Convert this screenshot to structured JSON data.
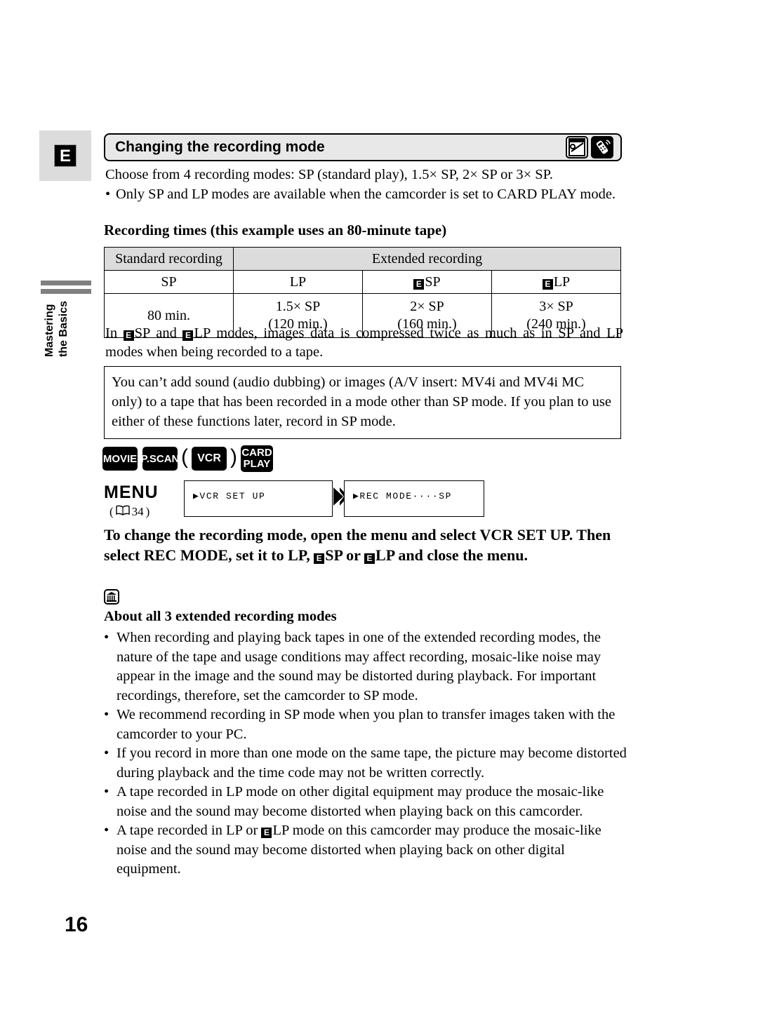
{
  "page": {
    "number": "16",
    "language_marker": "E",
    "side_tab": {
      "line1": "Mastering",
      "line2": "the Basics"
    }
  },
  "header": {
    "title": "Changing the recording mode",
    "icons": [
      "card-icon",
      "remote-control-icon"
    ]
  },
  "intro": {
    "paragraph": "Choose from 4 recording modes: SP (standard play), 1.5× SP, 2× SP or 3× SP.",
    "bullet_mark": "•",
    "bullet": "Only SP and LP modes are available when the camcorder is set to CARD PLAY mode."
  },
  "subhead": "Recording times (this example uses an 80-minute tape)",
  "chart_data": {
    "type": "table",
    "title": "Recording times (this example uses an 80-minute tape)",
    "group_headers": [
      {
        "label": "Standard recording",
        "span": 1
      },
      {
        "label": "Extended recording",
        "span": 3
      }
    ],
    "mode_row": [
      {
        "badge": "",
        "label": "SP"
      },
      {
        "badge": "",
        "label": "LP"
      },
      {
        "badge": "E",
        "label": "SP"
      },
      {
        "badge": "E",
        "label": "LP"
      }
    ],
    "time_row": [
      {
        "line1": "80 min.",
        "line2": ""
      },
      {
        "line1": "1.5× SP",
        "line2": "(120 min.)"
      },
      {
        "line1": "2× SP",
        "line2": "(160 min.)"
      },
      {
        "line1": "3× SP",
        "line2": "(240 min.)"
      }
    ]
  },
  "after_table": {
    "part1": "In ",
    "badge1": "E",
    "part2": "SP and ",
    "badge2": "E",
    "part3": "LP modes, images data is compressed twice as much as in SP and LP modes when being recorded to a tape."
  },
  "note_box": {
    "text": "You can’t add sound (audio dubbing) or images (A/V insert: MV4i and MV4i MC only) to a tape that has been recorded in a mode other than SP mode. If you plan to use either of these functions later, record in SP mode."
  },
  "badges": {
    "movie": "MOVIE",
    "pscan": "P.SCAN",
    "paren_open": "(",
    "vcr": "VCR",
    "paren_close": ")",
    "card_line1": "CARD",
    "card_line2": "PLAY"
  },
  "menu": {
    "label": "MENU",
    "ref_open": "(",
    "ref_page": "34",
    "ref_close": ")",
    "screen1": "▶VCR SET UP",
    "chevron": "❯❯",
    "screen2": "▶REC MODE····SP"
  },
  "instruction": {
    "part1": "To change the recording mode, open the menu and select VCR SET UP. Then select REC MODE, set it to LP, ",
    "badge1": "E",
    "part2": "SP or ",
    "badge2": "E",
    "part3": "LP and close the menu."
  },
  "about": {
    "icon": "note-icon",
    "heading": "About all 3 extended recording modes",
    "bullet_mark": "•",
    "bullets": [
      {
        "text": "When recording and playing back tapes in one of the extended recording modes, the nature of the tape and usage conditions may affect recording, mosaic-like noise may appear in the image and the sound may be distorted during playback. For important recordings, therefore, set the camcorder to SP mode."
      },
      {
        "text": "We recommend recording in SP mode when you plan to transfer images taken with the camcorder to your PC."
      },
      {
        "text": "If you record in more than one mode on the same tape, the picture may become distorted during playback and the time code may not be written correctly."
      },
      {
        "text": "A tape recorded in LP mode on other digital equipment may produce the mosaic-like noise and the sound may become distorted when playing back on this camcorder."
      },
      {
        "pre": "A tape recorded in LP or ",
        "badge": "E",
        "post": "LP mode on this camcorder may produce the mosaic-like noise and the sound may become distorted when playing back on other digital equipment."
      }
    ]
  },
  "colors": {
    "tab_gray": "#dcdcdc",
    "table_header_gray": "#dcdcdc",
    "side_bar_gray": "#808080",
    "badge_black": "#000000"
  }
}
